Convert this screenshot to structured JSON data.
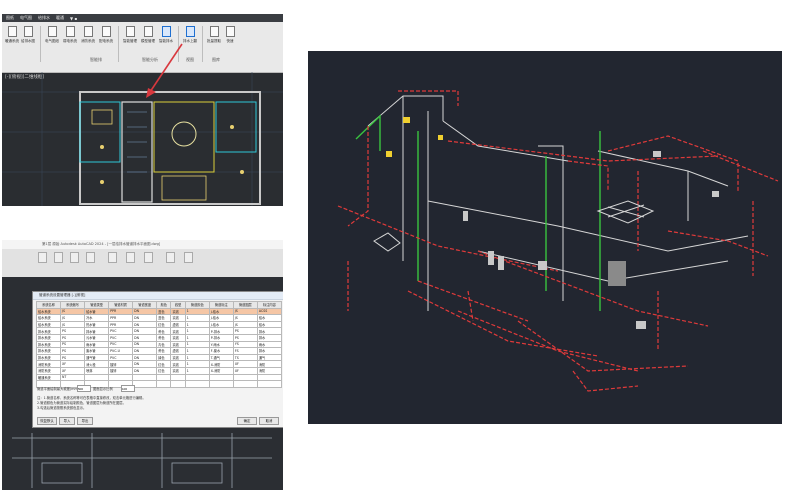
{
  "top_window": {
    "menu": [
      "图纸",
      "电气图",
      "给排水",
      "暖通",
      "▼ ▪"
    ],
    "ribbon_buttons": [
      {
        "label": "暖通系统",
        "icon": "hvac-system-icon"
      },
      {
        "label": "给排水图",
        "icon": "drainage-icon"
      },
      {
        "label": "电气图纸",
        "icon": "electric-icon"
      },
      {
        "label": "弱电系统",
        "icon": "low-voltage-icon"
      },
      {
        "label": "消防系统",
        "icon": "fire-icon"
      },
      {
        "label": "配电系统",
        "icon": "distribution-icon"
      },
      {
        "label": "智能管理",
        "icon": "smart-icon"
      },
      {
        "label": "模型管理",
        "icon": "model-icon"
      },
      {
        "label": "智能排水",
        "icon": "smart-drain-icon"
      },
      {
        "label": "排水上翻",
        "icon": "drain-up-icon"
      },
      {
        "label": "批量提取",
        "icon": "batch-icon"
      },
      {
        "label": "快速",
        "icon": "quick-icon"
      }
    ],
    "groups": [
      "智能排",
      "智能分析",
      "视图",
      "图库"
    ],
    "doc_title": "[-][俯视][二维线框]"
  },
  "bottom_window": {
    "title_text": "第1层 原始 Autodesk AutoCAD 2024 - [一层给排水管道排水平面图.dwg]",
    "dialog_title": "管道系统设置管理器 [-][俯视]",
    "columns": [
      "系统名称",
      "系统缩写",
      "管道类型",
      "管道材质",
      "管道宽度",
      "颜色",
      "线型",
      "管道颜色",
      "管道标注",
      "管道图层",
      "标注内容"
    ],
    "rows": [
      [
        "给水系统",
        "JS",
        "给水管",
        "PPR",
        "DN",
        "蓝色",
        "实线",
        "1",
        "J-给水",
        "JS",
        "ACSS"
      ],
      [
        "给水系统",
        "JS",
        "冷水",
        "PPR",
        "DN",
        "蓝色",
        "实线",
        "1",
        "J-给水",
        "JS",
        "给水"
      ],
      [
        "给水系统",
        "JS",
        "热水管",
        "PPR",
        "DN",
        "红色",
        "虚线",
        "1",
        "J-给水",
        "JS",
        "给水"
      ],
      [
        "排水系统",
        "PS",
        "排水管",
        "PVC",
        "DN",
        "黄色",
        "实线",
        "1",
        "P-排水",
        "PS",
        "排水"
      ],
      [
        "排水系统",
        "PS",
        "污水管",
        "PVC",
        "DN",
        "黄色",
        "实线",
        "1",
        "P-排水",
        "PS",
        "排水"
      ],
      [
        "排水系统",
        "PS",
        "雨水管",
        "PVC",
        "DN",
        "青色",
        "实线",
        "1",
        "Y-雨水",
        "YS",
        "雨水"
      ],
      [
        "排水系统",
        "PS",
        "废水管",
        "PVC-U",
        "DN",
        "黄色",
        "虚线",
        "1",
        "F-废水",
        "FS",
        "排水"
      ],
      [
        "排水系统",
        "PS",
        "通气管",
        "PVC",
        "DN",
        "绿色",
        "实线",
        "1",
        "T-通气",
        "TS",
        "通气"
      ],
      [
        "消防系统",
        "XF",
        "消火栓",
        "镀锌",
        "DN",
        "红色",
        "实线",
        "1",
        "X-消防",
        "XF",
        "消防"
      ],
      [
        "消防系统",
        "XF",
        "喷淋",
        "镀锌",
        "DN",
        "红色",
        "实线",
        "1",
        "X-消防",
        "XF",
        "消防"
      ],
      [
        "暖通系统",
        "NT",
        "",
        "",
        "",
        "",
        "",
        "",
        "",
        "",
        ""
      ],
      [
        "",
        "",
        "",
        "",
        "",
        "",
        "",
        "",
        "",
        "",
        ""
      ]
    ],
    "setting_label": "管道平面绘制最大坡度(mm)",
    "setting_value": "500",
    "setting2_label": "图面显示比例",
    "setting2_value": "100",
    "notes": [
      "注：1.管道名称、系统名称等可在表格中直接修改，双击单元格进行编辑。",
      "2.管道颜色为管道实际绘制颜色，管道图层为管道所在图层。",
      "3.勾选后管道按照系统颜色显示。"
    ],
    "buttons": {
      "left1": "恢复默认",
      "left2": "导入",
      "left3": "导出",
      "ok": "确定",
      "cancel": "取消"
    }
  },
  "colors": {
    "pipe_red": "#e03a3a",
    "pipe_white": "#e8e8e8",
    "pipe_green": "#39c33f",
    "accent_arrow": "#d8383e",
    "selection": "#f5c6a5"
  }
}
